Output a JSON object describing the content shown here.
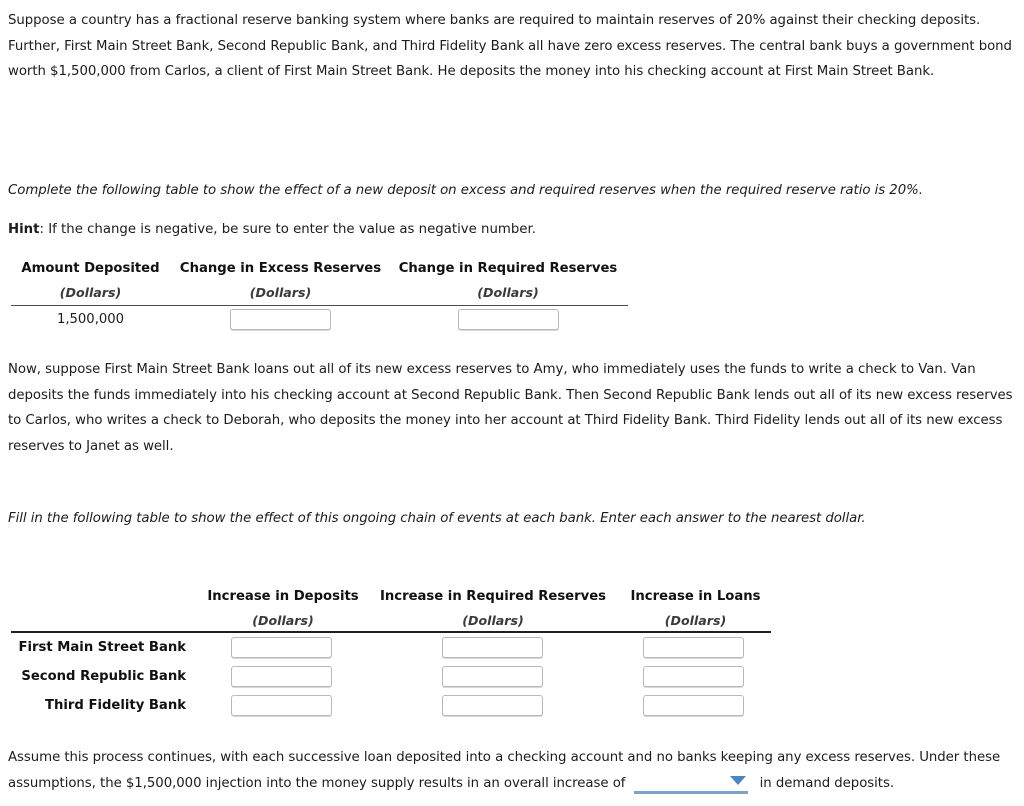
{
  "intro": {
    "paragraph": "Suppose a country has a fractional reserve banking system where banks are required to maintain reserves of 20% against their checking deposits. Further, First Main Street Bank, Second Republic Bank, and Third Fidelity Bank all have zero excess reserves. The central bank buys a government bond worth $1,500,000 from Carlos, a client of First Main Street Bank. He deposits the money into his checking account at First Main Street Bank."
  },
  "task1": {
    "instruction": "Complete the following table to show the effect of a new deposit on excess and required reserves when the required reserve ratio is 20%.",
    "hint_label": "Hint",
    "hint_text": ": If the change is negative, be sure to enter the value as negative number.",
    "table": {
      "headers": [
        "Amount Deposited",
        "Change in Excess Reserves",
        "Change in Required Reserves"
      ],
      "subheaders": [
        "(Dollars)",
        "(Dollars)",
        "(Dollars)"
      ],
      "rows": [
        {
          "amount_deposited": "1,500,000",
          "change_excess_reserves": "",
          "change_required_reserves": ""
        }
      ],
      "input_placeholder": ""
    }
  },
  "chain": {
    "paragraph": "Now, suppose First Main Street Bank loans out all of its new excess reserves to Amy, who immediately uses the funds to write a check to Van. Van deposits the funds immediately into his checking account at Second Republic Bank. Then Second Republic Bank lends out all of its new excess reserves to Carlos, who writes a check to Deborah, who deposits the money into her account at Third Fidelity Bank. Third Fidelity lends out all of its new excess reserves to Janet as well."
  },
  "task2": {
    "instruction": "Fill in the following table to show the effect of this ongoing chain of events at each bank. Enter each answer to the nearest dollar.",
    "table": {
      "corner_header": "",
      "headers": [
        "Increase in Deposits",
        "Increase in Required Reserves",
        "Increase in Loans"
      ],
      "subheaders": [
        "(Dollars)",
        "(Dollars)",
        "(Dollars)"
      ],
      "rows": [
        {
          "bank": "First Main Street Bank",
          "increase_deposits": "",
          "increase_required_reserves": "",
          "increase_loans": ""
        },
        {
          "bank": "Second Republic Bank",
          "increase_deposits": "",
          "increase_required_reserves": "",
          "increase_loans": ""
        },
        {
          "bank": "Third Fidelity Bank",
          "increase_deposits": "",
          "increase_required_reserves": "",
          "increase_loans": ""
        }
      ],
      "input_placeholder": ""
    }
  },
  "closing": {
    "text_before": "Assume this process continues, with each successive loan deposited into a checking account and no banks keeping any excess reserves. Under these assumptions, the $1,500,000 injection into the money supply results in an overall increase of",
    "dropdown_value": "",
    "dropdown_icon": "chevron-down-icon",
    "text_after": "in demand deposits."
  },
  "colors": {
    "dropdown_accent": "#7ba3ce",
    "dropdown_caret": "#4a86c5",
    "rule": "#4d4d4d",
    "rule_thick": "#1f1f1f",
    "input_border": "#b9b9b9"
  }
}
